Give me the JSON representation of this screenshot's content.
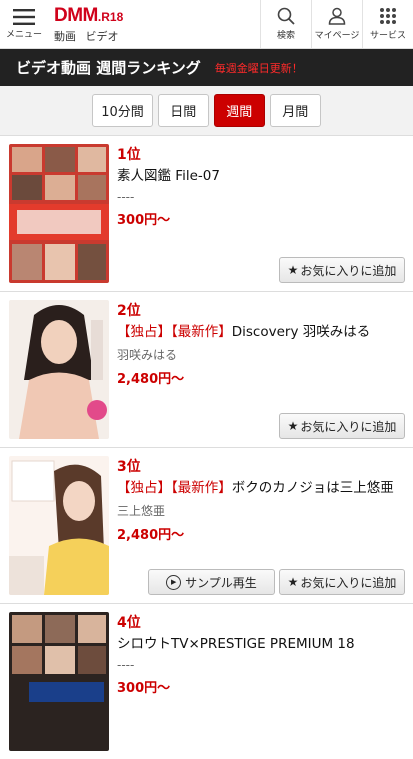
{
  "header": {
    "menu_label": "メニュー",
    "logo_main": "DMM",
    "logo_suffix": ".R18",
    "sub1": "動画",
    "sub2": "ビデオ",
    "search_label": "検索",
    "mypage_label": "マイページ",
    "service_label": "サービス"
  },
  "banner": {
    "title": "ビデオ動画 週間ランキング",
    "note": "毎週金曜日更新！"
  },
  "tabs": [
    {
      "label": "10分間",
      "active": false
    },
    {
      "label": "日間",
      "active": false
    },
    {
      "label": "週間",
      "active": true
    },
    {
      "label": "月間",
      "active": false
    }
  ],
  "items": [
    {
      "rank": "1位",
      "title_tags": "",
      "title": "素人図鑑 File-07",
      "actor": "----",
      "price": "300円〜",
      "fav_label": "お気に入りに追加",
      "sample_label": ""
    },
    {
      "rank": "2位",
      "title_tags": "【独占】【最新作】",
      "title": "Discovery 羽咲みはる",
      "actor": "羽咲みはる",
      "price": "2,480円〜",
      "fav_label": "お気に入りに追加",
      "sample_label": ""
    },
    {
      "rank": "3位",
      "title_tags": "【独占】【最新作】",
      "title": "ボクのカノジョは三上悠亜",
      "actor": "三上悠亜",
      "price": "2,480円〜",
      "fav_label": "お気に入りに追加",
      "sample_label": "サンプル再生"
    },
    {
      "rank": "4位",
      "title_tags": "",
      "title": "シロウトTV×PRESTIGE PREMIUM 18",
      "actor": "----",
      "price": "300円〜",
      "fav_label": "",
      "sample_label": ""
    }
  ],
  "colors": {
    "accent": "#cc0000",
    "brand": "#d0021b",
    "banner_bg": "#222222"
  }
}
